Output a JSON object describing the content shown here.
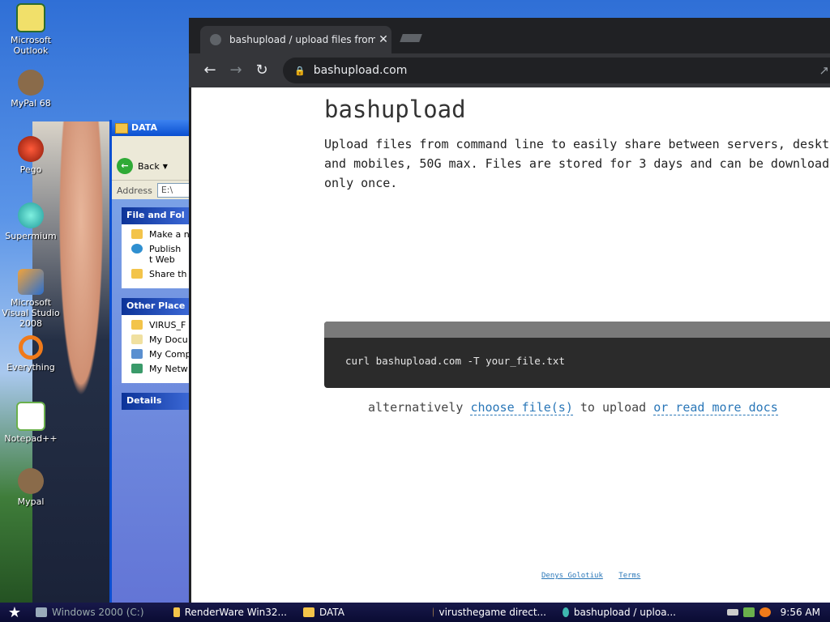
{
  "desktop": {
    "icons": [
      {
        "label": "Microsoft Outlook"
      },
      {
        "label": "MyPal 68"
      },
      {
        "label": "Pego"
      },
      {
        "label": "Supermium"
      },
      {
        "label": "Microsoft Visual Studio 2008"
      },
      {
        "label": "Everything"
      },
      {
        "label": "Notepad++"
      },
      {
        "label": "Mypal"
      }
    ]
  },
  "explorer": {
    "title": "DATA",
    "back_label": "Back",
    "address_label": "Address",
    "address_value": "E:\\",
    "tasks_header": "File and Fol",
    "tasks": [
      "Make a n",
      "Publish t Web",
      "Share th"
    ],
    "places_header": "Other Place",
    "places": [
      "VIRUS_F",
      "My Docu",
      "My Comp",
      "My Netw"
    ],
    "details_header": "Details"
  },
  "browser": {
    "tab_title": "bashupload / upload files from comm",
    "url": "bashupload.com",
    "page": {
      "heading": "bashupload",
      "description": "Upload files from command line to easily share between servers, desktops and mobiles, 50G max. Files are stored for 3 days and can be downloaded only once.",
      "command": "curl bashupload.com -T your_file.txt",
      "alt_prefix": "alternatively",
      "alt_link1": "choose file(s)",
      "alt_middle": "to upload",
      "alt_link2": "or read more docs",
      "footer_link1": "Denys Golotiuk",
      "footer_link2": "Terms"
    }
  },
  "taskbar": {
    "items": [
      "Windows 2000 (C:)",
      "RenderWare Win32...",
      "DATA",
      "virusthegame direct...",
      "bashupload / uploa..."
    ],
    "clock": "9:56 AM"
  }
}
